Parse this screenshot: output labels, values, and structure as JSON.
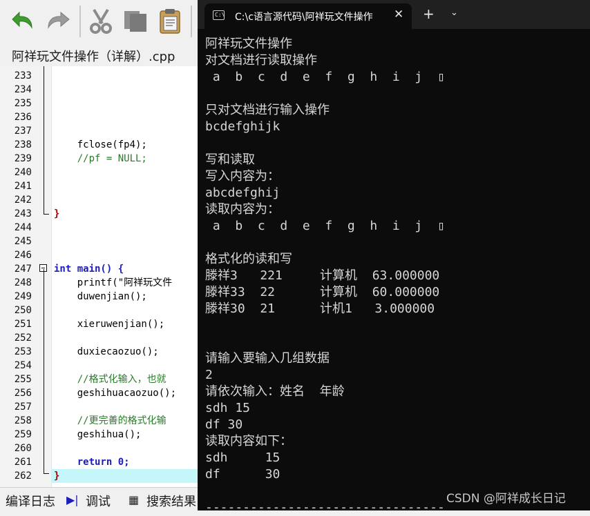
{
  "ide": {
    "toolbar": {
      "icons": [
        "undo-icon",
        "redo-icon",
        "cut-icon",
        "copy-icon",
        "paste-icon"
      ]
    },
    "file_tab": "阿祥玩文件操作（详解）.cpp",
    "lines": [
      {
        "n": "233",
        "code": ""
      },
      {
        "n": "234",
        "code": ""
      },
      {
        "n": "235",
        "code": ""
      },
      {
        "n": "236",
        "code": ""
      },
      {
        "n": "237",
        "code": ""
      },
      {
        "n": "238",
        "code": "    fclose(fp4);"
      },
      {
        "n": "239",
        "code": "    //pf = NULL;"
      },
      {
        "n": "240",
        "code": ""
      },
      {
        "n": "241",
        "code": ""
      },
      {
        "n": "242",
        "code": ""
      },
      {
        "n": "243",
        "code": "}"
      },
      {
        "n": "244",
        "code": ""
      },
      {
        "n": "245",
        "code": ""
      },
      {
        "n": "246",
        "code": ""
      },
      {
        "n": "247",
        "code": "int main() {"
      },
      {
        "n": "248",
        "code": "    printf(\"阿祥玩文件"
      },
      {
        "n": "249",
        "code": "    duwenjian();"
      },
      {
        "n": "250",
        "code": ""
      },
      {
        "n": "251",
        "code": "    xieruwenjian();"
      },
      {
        "n": "252",
        "code": ""
      },
      {
        "n": "253",
        "code": "    duxiecaozuo();"
      },
      {
        "n": "254",
        "code": ""
      },
      {
        "n": "255",
        "code": "    //格式化输入，也就"
      },
      {
        "n": "256",
        "code": "    geshihuacaozuo();"
      },
      {
        "n": "257",
        "code": ""
      },
      {
        "n": "258",
        "code": "    //更完善的格式化输"
      },
      {
        "n": "259",
        "code": "    geshihua();"
      },
      {
        "n": "260",
        "code": ""
      },
      {
        "n": "261",
        "code": "    return 0;"
      },
      {
        "n": "262",
        "code": "}"
      }
    ],
    "bottom_tabs": {
      "compile_log": "编译日志",
      "debug": "调试",
      "search_results": "搜索结果"
    }
  },
  "terminal": {
    "tab_title": "C:\\c语言源代码\\阿祥玩文件操作",
    "icon_text": "C:\\",
    "close_glyph": "✕",
    "new_tab_glyph": "+",
    "dropdown_glyph": "⌄",
    "output": [
      "阿祥玩文件操作",
      "对文档进行读取操作",
      " a  b  c  d  e  f  g  h  i  j  ▯",
      "",
      "只对文档进行输入操作",
      "bcdefghijk",
      "",
      "写和读取",
      "写入内容为：",
      "abcdefghij",
      "读取内容为：",
      " a  b  c  d  e  f  g  h  i  j  ▯",
      "",
      "格式化的读和写",
      "滕祥3   221     计算机  63.000000",
      "滕祥33  22      计算机  60.000000",
      "滕祥30  21      计机1   3.000000",
      "",
      "",
      "请输入要输入几组数据",
      "2",
      "请依次输入：姓名  年龄",
      "sdh 15",
      "df 30",
      "读取内容如下：",
      "sdh     15",
      "df      30",
      "",
      "--------------------------------"
    ],
    "watermark": "CSDN @阿祥成长日记"
  }
}
